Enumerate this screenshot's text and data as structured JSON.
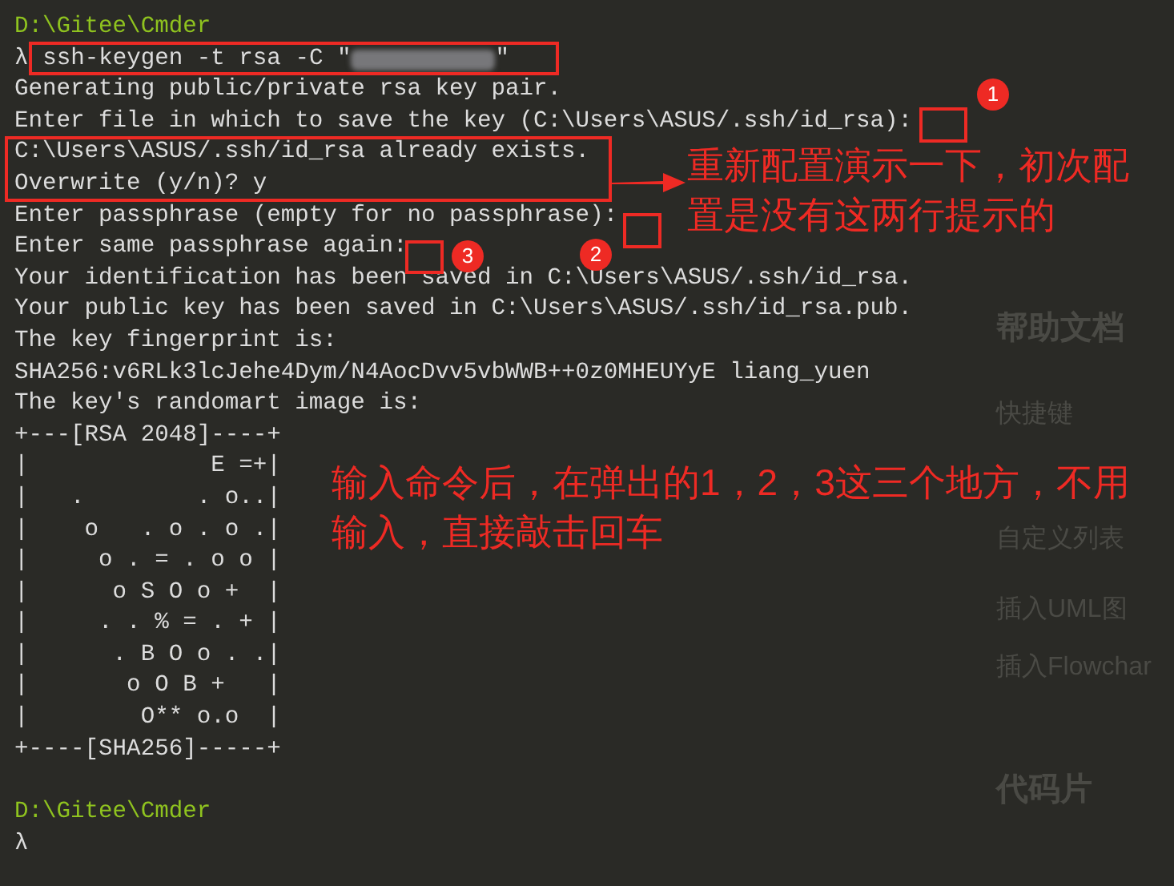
{
  "terminal": {
    "lines": [
      {
        "kind": "path",
        "text": "D:\\Gitee\\Cmder"
      },
      {
        "kind": "command",
        "prompt": "λ",
        "text": "ssh-keygen -t rsa -C \"",
        "redacted": true,
        "closing": "\""
      },
      {
        "kind": "output",
        "text": "Generating public/private rsa key pair."
      },
      {
        "kind": "output",
        "text": "Enter file in which to save the key (C:\\Users\\ASUS/.ssh/id_rsa):"
      },
      {
        "kind": "output",
        "text": "C:\\Users\\ASUS/.ssh/id_rsa already exists."
      },
      {
        "kind": "output",
        "text": "Overwrite (y/n)? y"
      },
      {
        "kind": "output",
        "text": "Enter passphrase (empty for no passphrase):"
      },
      {
        "kind": "output",
        "text": "Enter same passphrase again:"
      },
      {
        "kind": "output",
        "text": "Your identification has been saved in C:\\Users\\ASUS/.ssh/id_rsa."
      },
      {
        "kind": "output",
        "text": "Your public key has been saved in C:\\Users\\ASUS/.ssh/id_rsa.pub."
      },
      {
        "kind": "output",
        "text": "The key fingerprint is:"
      },
      {
        "kind": "output",
        "text": "SHA256:v6RLk3lcJehe4Dym/N4AocDvv5vbWWB++0z0MHEUYyE liang_yuen"
      },
      {
        "kind": "output",
        "text": "The key's randomart image is:"
      },
      {
        "kind": "art",
        "text": "+---[RSA 2048]----+"
      },
      {
        "kind": "art",
        "text": "|             E =+|"
      },
      {
        "kind": "art",
        "text": "|   .        . o..|"
      },
      {
        "kind": "art",
        "text": "|    o   . o . o .|"
      },
      {
        "kind": "art",
        "text": "|     o . = . o o |"
      },
      {
        "kind": "art",
        "text": "|      o S O o +  |"
      },
      {
        "kind": "art",
        "text": "|     . . % = . + |"
      },
      {
        "kind": "art",
        "text": "|      . B O o . .|"
      },
      {
        "kind": "art",
        "text": "|       o O B +   |"
      },
      {
        "kind": "art",
        "text": "|        O** o.o  |"
      },
      {
        "kind": "art",
        "text": "+----[SHA256]-----+"
      },
      {
        "kind": "blank"
      },
      {
        "kind": "path",
        "text": "D:\\Gitee\\Cmder"
      },
      {
        "kind": "command",
        "prompt": "λ"
      }
    ]
  },
  "annotations": {
    "markers": [
      {
        "number": "1"
      },
      {
        "number": "2"
      },
      {
        "number": "3"
      }
    ],
    "notes": [
      {
        "lines": [
          "重新配置演示一下，初次配",
          "置是没有这两行提示的"
        ]
      },
      {
        "lines": [
          "输入命令后，在弹出的1，2，3这三个地方，不用",
          "输入，直接敲击回车"
        ]
      }
    ]
  },
  "background_sidebar": {
    "items": [
      {
        "kind": "heading",
        "text": "帮助文档"
      },
      {
        "kind": "item",
        "text": "快捷键"
      },
      {
        "kind": "item",
        "text": "自定义列表"
      },
      {
        "kind": "item",
        "text": "插入UML图"
      },
      {
        "kind": "item",
        "text": "插入Flowchar"
      },
      {
        "kind": "heading",
        "text": "代码片"
      }
    ]
  }
}
